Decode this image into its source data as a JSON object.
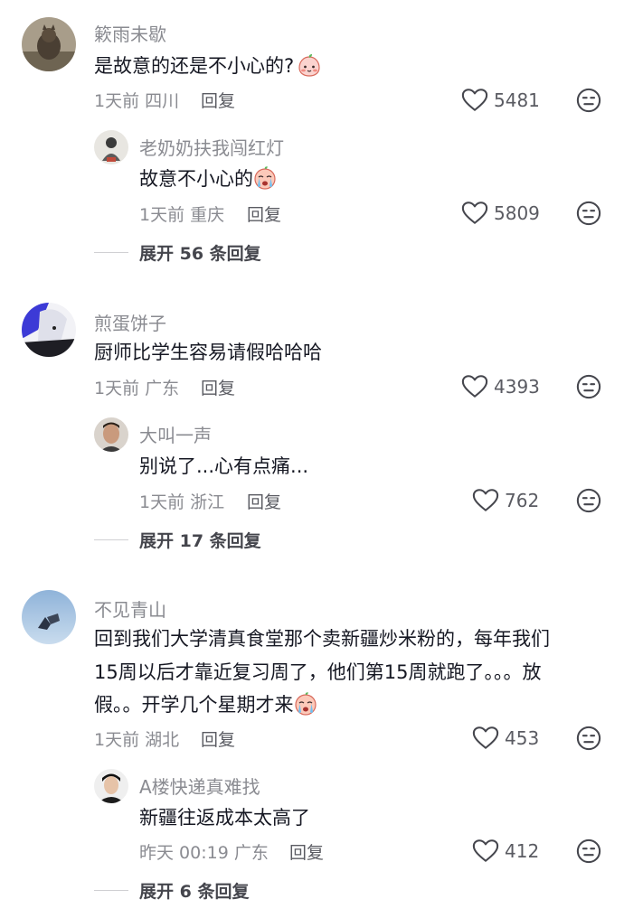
{
  "threads": [
    {
      "comment": {
        "username": "簌雨未歇",
        "text": "是故意的还是不小心的?",
        "time": "1天前",
        "location": "四川",
        "reply_label": "回复",
        "likes": "5481"
      },
      "reply": {
        "username": "老奶奶扶我闯红灯",
        "text": "故意不小心的",
        "time": "1天前",
        "location": "重庆",
        "reply_label": "回复",
        "likes": "5809"
      },
      "expand_label": "展开 56 条回复"
    },
    {
      "comment": {
        "username": "煎蛋饼子",
        "text": "厨师比学生容易请假哈哈哈",
        "time": "1天前",
        "location": "广东",
        "reply_label": "回复",
        "likes": "4393"
      },
      "reply": {
        "username": "大叫一声",
        "text": "别说了...心有点痛...",
        "time": "1天前",
        "location": "浙江",
        "reply_label": "回复",
        "likes": "762"
      },
      "expand_label": "展开 17 条回复"
    },
    {
      "comment": {
        "username": "不见青山",
        "text_lines": [
          "回到我们大学清真食堂那个卖新疆炒米粉的，每年我们",
          "15周以后才靠近复习周了，他们第15周就跑了。。。放",
          "假。。开学几个星期才来"
        ],
        "time": "1天前",
        "location": "湖北",
        "reply_label": "回复",
        "likes": "453"
      },
      "reply": {
        "username": "A楼快递真难找",
        "text": "新疆往返成本太高了",
        "time": "昨天 00:19",
        "location": "广东",
        "reply_label": "回复",
        "likes": "412"
      },
      "expand_label": "展开 6 条回复"
    }
  ],
  "icons": {
    "like": "heart-outline-icon",
    "dislike": "unamused-face-icon",
    "emoji_peach": "shy-peach-emoji",
    "emoji_crying": "crying-face-emoji"
  },
  "colors": {
    "username": "#8a8b91",
    "text": "#161823",
    "meta": "#8a8b91"
  }
}
